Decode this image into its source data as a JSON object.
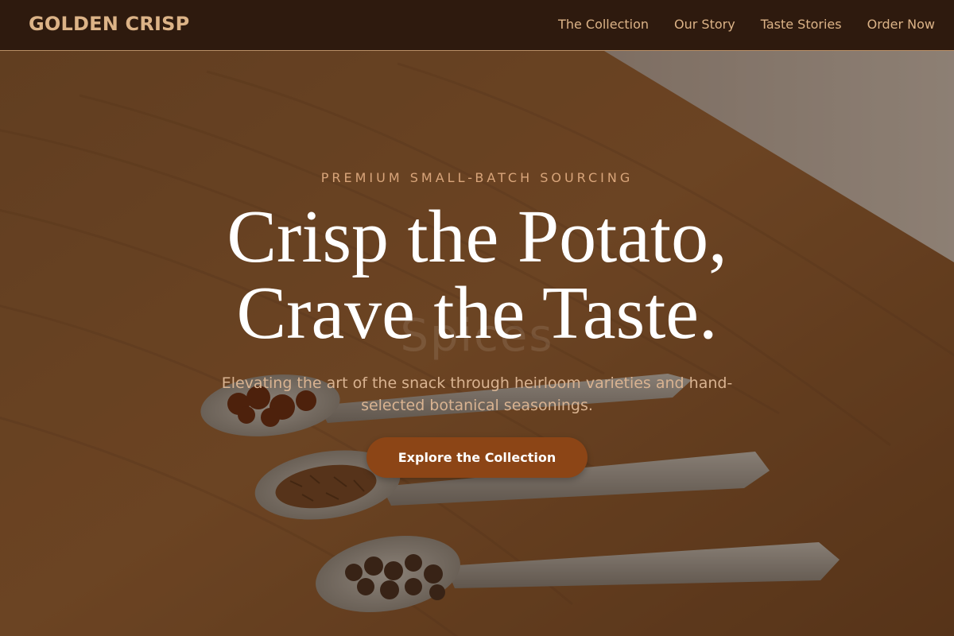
{
  "brand": {
    "name": "GOLDEN CRISP"
  },
  "nav": {
    "items": [
      {
        "label": "The Collection"
      },
      {
        "label": "Our Story"
      },
      {
        "label": "Taste Stories"
      },
      {
        "label": "Order Now"
      }
    ]
  },
  "hero": {
    "eyebrow": "PREMIUM SMALL-BATCH SOURCING",
    "headline_line1": "Crisp the Potato,",
    "headline_line2": "Crave the Taste.",
    "watermark": "Spices",
    "subtext": "Elevating the art of the snack through heirloom varieties and hand-selected botanical seasonings.",
    "cta_label": "Explore the Collection",
    "background_image": "spoons-with-spices-on-wooden-table"
  },
  "colors": {
    "nav_bg": "#2e1a0e",
    "brand_text": "#dcb387",
    "nav_border": "#b98f66",
    "eyebrow": "#d9a57a",
    "headline": "#ffffff",
    "subtext": "#d9b391",
    "cta_bg": "#8c4516",
    "cta_text": "#ffffff"
  }
}
